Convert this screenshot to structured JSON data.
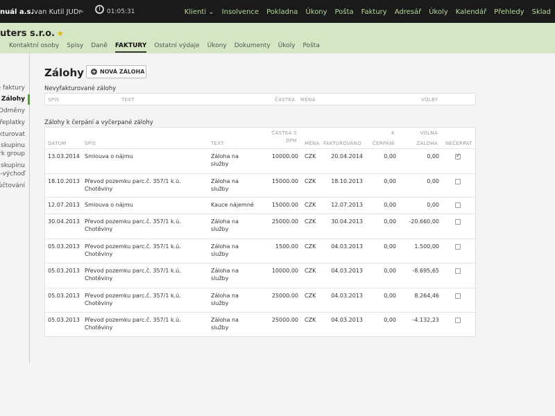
{
  "topbar": {
    "firm": "nuál a.s.",
    "user": "Ivan Kutil JUDr",
    "timer": "01:05:31",
    "nav": [
      "Klienti",
      "Insolvence",
      "Pokladna",
      "Úkony",
      "Pošta",
      "Faktury",
      "Adresář",
      "Úkoly",
      "Kalendář",
      "Přehledy",
      "Sklad"
    ]
  },
  "client": {
    "name": "uters s.r.o.",
    "subnav": [
      "Kontaktní osoby",
      "Spisy",
      "Daně",
      "FAKTURY",
      "Ostatní výdaje",
      "Úkony",
      "Dokumenty",
      "Úkoly",
      "Pošta"
    ],
    "active_subnav": "FAKTURY"
  },
  "sidebar": {
    "items": [
      "é faktury",
      "Zálohy",
      "Odměny",
      "Přeplatky",
      "akturovat",
      "t skupinu",
      "erk group",
      "t skupinu",
      "a-výchoď",
      "účtování"
    ],
    "active": "Zálohy"
  },
  "page": {
    "title": "Zálohy",
    "new_button": "NOVÁ ZÁLOHA"
  },
  "unbilled": {
    "title": "Nevyfakturované zálohy",
    "headers": [
      "SPIS",
      "TEXT",
      "ČÁSTKA",
      "MĚNA",
      "VOLBY"
    ]
  },
  "advances": {
    "title": "Zálohy k čerpání a vyčerpané zálohy",
    "headers": {
      "datum": "DATUM",
      "spis": "SPIS",
      "text": "TEXT",
      "castka_1": "ČÁSTKA S",
      "castka_2": "DPH",
      "mena": "MĚNA",
      "fakturovano": "FAKTUROVÁNO",
      "cerpani_1": "K",
      "cerpani_2": "ČERPÁNÍ",
      "volna_1": "VOLNÁ",
      "volna_2": "ZÁLOHA",
      "necerpat": "NEČERPAT"
    },
    "rows": [
      {
        "date": "13.03.2014",
        "spis1": "Smlouva o nájmu",
        "spis2": "",
        "text1": "Záloha na",
        "text2": "služby",
        "amount": "10000.00",
        "currency": "CZK",
        "invoiced": "20.04.2014",
        "draw": "0,00",
        "free": "0,00",
        "checked": true
      },
      {
        "date": "18.10.2013",
        "spis1": "Převod pozemku parc.č. 357/1 k.ú.",
        "spis2": "Chotěviny",
        "text1": "Záloha na",
        "text2": "služby",
        "amount": "15000.00",
        "currency": "CZK",
        "invoiced": "18.10.2013",
        "draw": "0,00",
        "free": "0,00",
        "checked": false
      },
      {
        "date": "12.07.2013",
        "spis1": "Smlouva o nájmu",
        "spis2": "",
        "text1": "Kauce nájemné",
        "text2": "",
        "amount": "15000.00",
        "currency": "CZK",
        "invoiced": "12.07.2013",
        "draw": "0,00",
        "free": "0,00",
        "checked": false
      },
      {
        "date": "30.04.2013",
        "spis1": "Převod pozemku parc.č. 357/1 k.ú.",
        "spis2": "Chotěviny",
        "text1": "Záloha na",
        "text2": "služby",
        "amount": "25000.00",
        "currency": "CZK",
        "invoiced": "30.04.2013",
        "draw": "0,00",
        "free": "-20.660,00",
        "checked": false
      },
      {
        "date": "05.03.2013",
        "spis1": "Převod pozemku parc.č. 357/1 k.ú.",
        "spis2": "Chotěviny",
        "text1": "Záloha na",
        "text2": "služby",
        "amount": "1500.00",
        "currency": "CZK",
        "invoiced": "04.03.2013",
        "draw": "0,00",
        "free": "1.500,00",
        "checked": false
      },
      {
        "date": "05.03.2013",
        "spis1": "Převod pozemku parc.č. 357/1 k.ú.",
        "spis2": "Chotěviny",
        "text1": "Záloha na",
        "text2": "služby",
        "amount": "10000.00",
        "currency": "CZK",
        "invoiced": "04.03.2013",
        "draw": "0,00",
        "free": "-8.695,65",
        "checked": false
      },
      {
        "date": "05.03.2013",
        "spis1": "Převod pozemku parc.č. 357/1 k.ú.",
        "spis2": "Chotěviny",
        "text1": "Záloha na",
        "text2": "služby",
        "amount": "25000.00",
        "currency": "CZK",
        "invoiced": "04.03.2013",
        "draw": "0,00",
        "free": "8.264,46",
        "checked": false
      },
      {
        "date": "05.03.2013",
        "spis1": "Převod pozemku parc.č. 357/1 k.ú.",
        "spis2": "Chotěviny",
        "text1": "Záloha na",
        "text2": "služby",
        "amount": "25000.00",
        "currency": "CZK",
        "invoiced": "04.03.2013",
        "draw": "0,00",
        "free": "-4.132,23",
        "checked": false
      }
    ]
  }
}
